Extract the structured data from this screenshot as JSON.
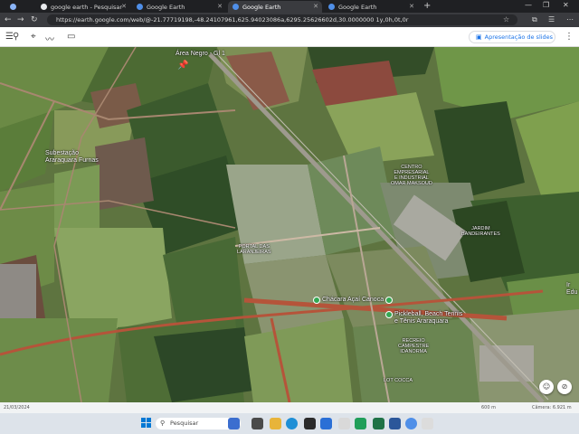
{
  "browser": {
    "tabs": [
      {
        "label": "google earth - Pesquisar",
        "active": false,
        "favicon_color": "#e8eaed"
      },
      {
        "label": "Google Earth",
        "active": false,
        "favicon_color": "#4f8fe8"
      },
      {
        "label": "Google Earth",
        "active": true,
        "favicon_color": "#4f8fe8"
      },
      {
        "label": "Google Earth",
        "active": false,
        "favicon_color": "#4f8fe8"
      }
    ],
    "new_tab": "+",
    "url": "https://earth.google.com/web/@-21.77719198,-48.24107961,625.94023086a,6295.25626602d,30.0000000 1y,0h,0t,0r"
  },
  "earth_toolbar": {
    "presentation_label": "Apresentação de slides"
  },
  "map": {
    "labels": {
      "area_negro": "Área Negro - Gl 1",
      "subestacao": "Subestação\nAraraquara Furnas",
      "centro": "CENTRO\nEMPRESARIAL\nE INDUSTRIAL\nOMAR MAKSOUD",
      "jardim": "JARDIM\nBANDEIRANTES",
      "portal": "PORTAL DAS\nLARANJEIRAS",
      "chacara": "Chácara Açaí Canoca",
      "pickleball": "Pickleball, Beach Tennis\ne Tênis Araraquara",
      "recreio": "RECREIO\nCAMPESTRE\nIDANORMA",
      "lot": "LOT COCCA",
      "edge": "Ir\nEdu"
    }
  },
  "status": {
    "date": "21/03/2024",
    "scale": "600 m",
    "camera": "Câmera: 6.921 m"
  },
  "taskbar": {
    "search_placeholder": "Pesquisar"
  },
  "colors": {
    "road": "#9e9a8e",
    "red_road": "#b5543a",
    "pin_green": "#34a853",
    "accent_blue": "#1a73e8"
  }
}
